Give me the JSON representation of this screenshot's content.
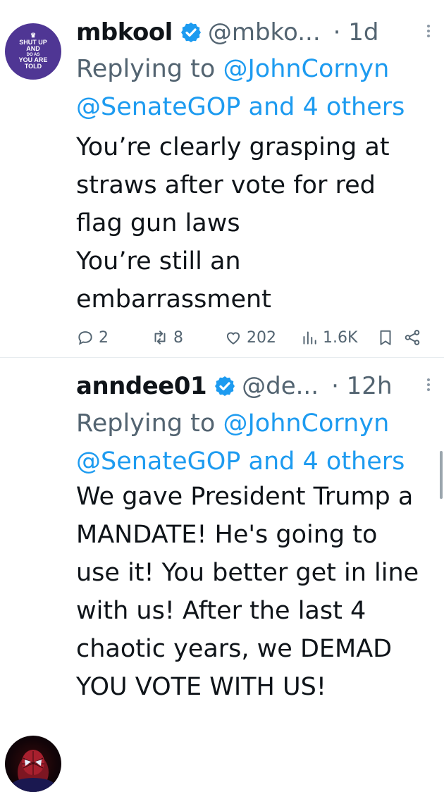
{
  "tweets": [
    {
      "avatar": {
        "lines": [
          "SHUT UP",
          "AND",
          "DO AS",
          "YOU ARE",
          "TOLD"
        ]
      },
      "name": "mbkool",
      "handle": "@mbko...",
      "time": "· 1d",
      "replying_prefix": "Replying to ",
      "replying_to_1": "@JohnCornyn",
      "replying_to_2": "@SenateGOP and 4 others",
      "body_lines": [
        "You’re clearly grasping at",
        "straws after vote for red",
        "flag gun laws",
        "You’re still an",
        "embarrassment"
      ],
      "stats": {
        "replies": "2",
        "reposts": "8",
        "likes": "202",
        "views": "1.6K"
      }
    },
    {
      "name": "anndee01",
      "handle": "@de...",
      "time": "· 12h",
      "replying_prefix": "Replying to ",
      "replying_to_1": "@JohnCornyn",
      "replying_to_2": "@SenateGOP and 4 others",
      "body_lines": [
        "We gave President Trump a",
        "MANDATE! He's going to",
        "use it! You better get in line",
        "with us! After the last 4",
        "chaotic years, we DEMAD",
        "YOU VOTE WITH US!"
      ]
    }
  ],
  "icons": {
    "verified": "verified-badge-icon",
    "reply": "reply-icon",
    "repost": "repost-icon",
    "like": "heart-icon",
    "views": "views-icon",
    "bookmark": "bookmark-icon",
    "share": "share-icon",
    "more": "more-icon"
  },
  "colors": {
    "accent": "#1d9bf0",
    "muted": "#536471"
  }
}
